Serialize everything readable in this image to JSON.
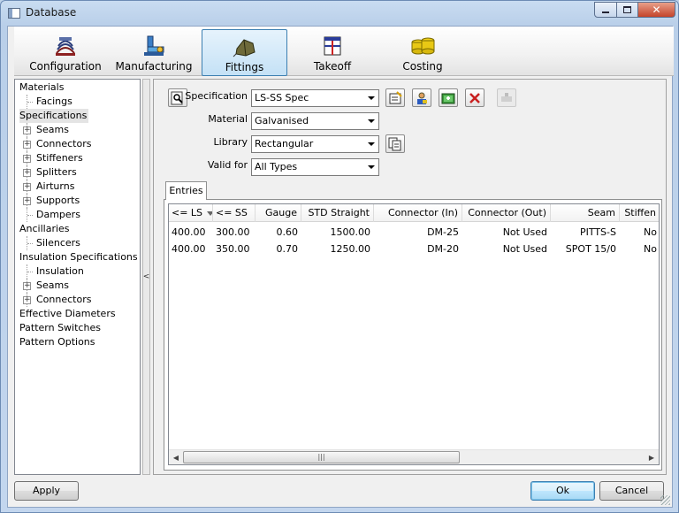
{
  "window": {
    "title": "Database"
  },
  "toolbar": [
    {
      "label": "Configuration",
      "icon": "ductwork-icon"
    },
    {
      "label": "Manufacturing",
      "icon": "machine-icon"
    },
    {
      "label": "Fittings",
      "icon": "fittings-icon"
    },
    {
      "label": "Takeoff",
      "icon": "takeoff-icon"
    },
    {
      "label": "Costing",
      "icon": "coins-icon"
    }
  ],
  "tree": [
    {
      "label": "Materials",
      "level": 0,
      "expander": false
    },
    {
      "label": "Facings",
      "level": 1,
      "expander": false
    },
    {
      "label": "Specifications",
      "level": 0,
      "expander": false,
      "selected": true
    },
    {
      "label": "Seams",
      "level": 1,
      "expander": true
    },
    {
      "label": "Connectors",
      "level": 1,
      "expander": true
    },
    {
      "label": "Stiffeners",
      "level": 1,
      "expander": true
    },
    {
      "label": "Splitters",
      "level": 1,
      "expander": true
    },
    {
      "label": "Airturns",
      "level": 1,
      "expander": true
    },
    {
      "label": "Supports",
      "level": 1,
      "expander": true
    },
    {
      "label": "Dampers",
      "level": 1,
      "expander": false
    },
    {
      "label": "Ancillaries",
      "level": 0,
      "expander": false
    },
    {
      "label": "Silencers",
      "level": 1,
      "expander": false
    },
    {
      "label": "Insulation Specifications",
      "level": 0,
      "expander": false
    },
    {
      "label": "Insulation",
      "level": 1,
      "expander": false
    },
    {
      "label": "Seams",
      "level": 1,
      "expander": true
    },
    {
      "label": "Connectors",
      "level": 1,
      "expander": true
    },
    {
      "label": "Effective Diameters",
      "level": 0,
      "expander": false
    },
    {
      "label": "Pattern Switches",
      "level": 0,
      "expander": false
    },
    {
      "label": "Pattern Options",
      "level": 0,
      "expander": false
    }
  ],
  "splitter": {
    "glyph": "<"
  },
  "form": {
    "specification": {
      "label": "Specification",
      "value": "LS-SS Spec"
    },
    "material": {
      "label": "Material",
      "value": "Galvanised"
    },
    "library": {
      "label": "Library",
      "value": "Rectangular"
    },
    "valid_for": {
      "label": "Valid for",
      "value": "All Types"
    }
  },
  "tabs": {
    "entries": "Entries"
  },
  "grid": {
    "columns": [
      "<= LS",
      "<= SS",
      "Gauge",
      "STD Straight",
      "Connector (In)",
      "Connector (Out)",
      "Seam",
      "Stiffen"
    ],
    "rows": [
      [
        "400.00",
        "300.00",
        "0.60",
        "1500.00",
        "DM-25",
        "Not Used",
        "PITTS-S",
        "No"
      ],
      [
        "400.00",
        "350.00",
        "0.70",
        "1250.00",
        "DM-20",
        "Not Used",
        "SPOT 15/0",
        "No"
      ]
    ]
  },
  "buttons": {
    "apply": "Apply",
    "ok": "Ok",
    "cancel": "Cancel"
  }
}
